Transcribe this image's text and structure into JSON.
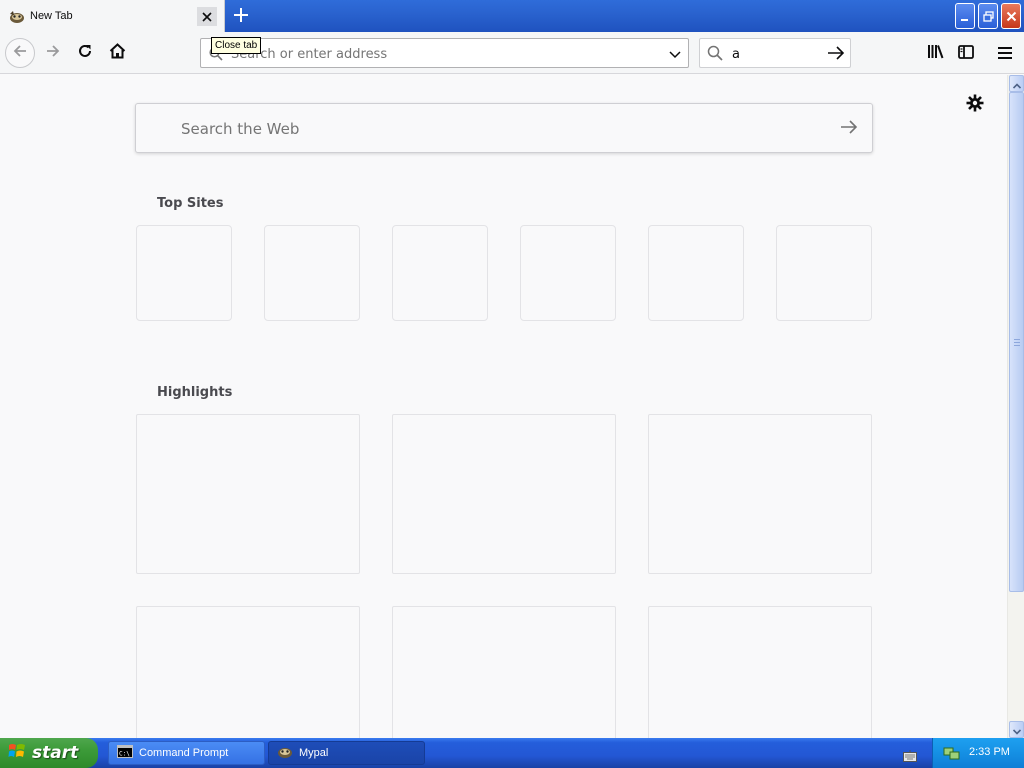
{
  "tab": {
    "title": "New Tab",
    "close_tooltip": "Close tab"
  },
  "urlbar": {
    "placeholder": "Search or enter address"
  },
  "searchbar": {
    "value": "a"
  },
  "newtab": {
    "web_search_placeholder": "Search the Web",
    "top_sites_title": "Top Sites",
    "highlights_title": "Highlights",
    "top_sites_count": 6,
    "highlight_cards_count": 6
  },
  "taskbar": {
    "start_label": "start",
    "tasks": [
      {
        "label": "Command Prompt",
        "icon": "cmd-icon",
        "active": false
      },
      {
        "label": "Mypal",
        "icon": "mypal-icon",
        "active": true
      }
    ],
    "clock": "2:33 PM"
  },
  "colors": {
    "titlebar": "#2a63cf",
    "toolbar": "#f5f6f7",
    "content_bg": "#f9f9fa",
    "start_button": "#3c9b39",
    "tray": "#1590e4"
  }
}
